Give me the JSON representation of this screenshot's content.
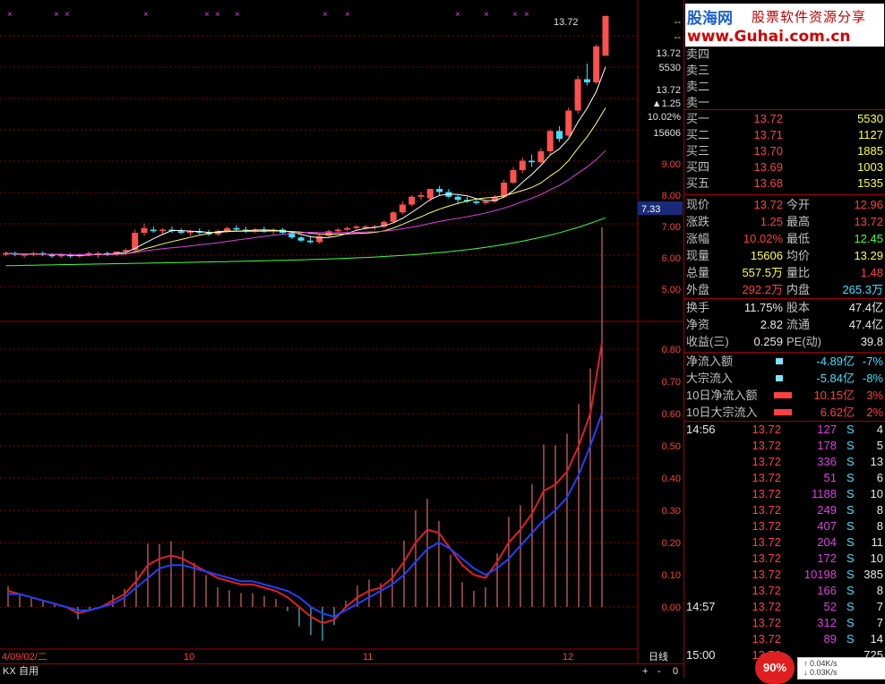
{
  "chart": {
    "price_axis": [
      "--",
      "--",
      "13.72",
      "5530",
      "13.72",
      "▲1.25",
      "10.02%",
      "15606",
      "9.00",
      "8.00",
      "7.00",
      "6.00",
      "5.00"
    ],
    "price_axis_highlight": "7.33",
    "top_label": "13.72",
    "indicator_axis": [
      "0.80",
      "0.70",
      "0.60",
      "0.50",
      "0.40",
      "0.30",
      "0.20",
      "0.10",
      "0.00"
    ],
    "date_labels": [
      "4/09/02/二",
      "10",
      "11",
      "12"
    ],
    "period_label": "日线",
    "bottom_tabs": [
      "KX",
      "自用"
    ],
    "zoom_buttons": [
      "+",
      "-",
      "0"
    ],
    "colors": {
      "up": "#ff5050",
      "down": "#40e0ff",
      "ma5": "#ffffff",
      "ma10": "#ffff60",
      "ma20": "#e040e0",
      "ma60": "#40ff40",
      "grid": "#8b0000"
    }
  },
  "logo": {
    "brand": "股海网",
    "slogan": "股票软件资源分享",
    "url": "www.Guhai.com.cn"
  },
  "order_book": {
    "sells": [
      {
        "label": "卖四",
        "price": "",
        "vol": ""
      },
      {
        "label": "卖三",
        "price": "",
        "vol": ""
      },
      {
        "label": "卖二",
        "price": "",
        "vol": ""
      },
      {
        "label": "卖一",
        "price": "",
        "vol": ""
      }
    ],
    "buys": [
      {
        "label": "买一",
        "price": "13.72",
        "vol": "5530"
      },
      {
        "label": "买二",
        "price": "13.71",
        "vol": "1127"
      },
      {
        "label": "买三",
        "price": "13.70",
        "vol": "1885"
      },
      {
        "label": "买四",
        "price": "13.69",
        "vol": "1003"
      },
      {
        "label": "买五",
        "price": "13.68",
        "vol": "1535"
      }
    ]
  },
  "quote": [
    {
      "l1": "现价",
      "v1": "13.72",
      "l2": "今开",
      "v2": "12.96"
    },
    {
      "l1": "涨跌",
      "v1": "1.25",
      "l2": "最高",
      "v2": "13.72"
    },
    {
      "l1": "涨幅",
      "v1": "10.02%",
      "l2": "最低",
      "v2": "12.45"
    },
    {
      "l1": "现量",
      "v1": "15606",
      "l2": "均价",
      "v2": "13.29"
    },
    {
      "l1": "总量",
      "v1": "557.5万",
      "l2": "量比",
      "v2": "1.48"
    },
    {
      "l1": "外盘",
      "v1": "292.2万",
      "l2": "内盘",
      "v2": "265.3万"
    }
  ],
  "fundamentals": [
    {
      "l1": "换手",
      "v1": "11.75%",
      "l2": "股本",
      "v2": "47.4亿"
    },
    {
      "l1": "净资",
      "v1": "2.82",
      "l2": "流通",
      "v2": "47.4亿"
    },
    {
      "l1": "收益(三)",
      "v1": "0.259",
      "l2": "PE(动)",
      "v2": "39.8"
    }
  ],
  "flows": [
    {
      "label": "净流入额",
      "value": "-4.89亿",
      "pct": "-7%"
    },
    {
      "label": "大宗流入",
      "value": "-5.84亿",
      "pct": "-8%"
    },
    {
      "label": "10日净流入额",
      "value": "10.15亿",
      "pct": "3%"
    },
    {
      "label": "10日大宗流入",
      "value": "6.62亿",
      "pct": "2%"
    }
  ],
  "ticks": [
    {
      "time": "14:56",
      "price": "13.72",
      "vol": "127",
      "side": "S",
      "n": "4"
    },
    {
      "time": "",
      "price": "13.72",
      "vol": "178",
      "side": "S",
      "n": "5"
    },
    {
      "time": "",
      "price": "13.72",
      "vol": "336",
      "side": "S",
      "n": "13"
    },
    {
      "time": "",
      "price": "13.72",
      "vol": "51",
      "side": "S",
      "n": "6"
    },
    {
      "time": "",
      "price": "13.72",
      "vol": "1188",
      "side": "S",
      "n": "10"
    },
    {
      "time": "",
      "price": "13.72",
      "vol": "249",
      "side": "S",
      "n": "8"
    },
    {
      "time": "",
      "price": "13.72",
      "vol": "407",
      "side": "S",
      "n": "8"
    },
    {
      "time": "",
      "price": "13.72",
      "vol": "204",
      "side": "S",
      "n": "11"
    },
    {
      "time": "",
      "price": "13.72",
      "vol": "172",
      "side": "S",
      "n": "10"
    },
    {
      "time": "",
      "price": "13.72",
      "vol": "10198",
      "side": "S",
      "n": "385"
    },
    {
      "time": "",
      "price": "13.72",
      "vol": "166",
      "side": "S",
      "n": "8"
    },
    {
      "time": "14:57",
      "price": "13.72",
      "vol": "52",
      "side": "S",
      "n": "7"
    },
    {
      "time": "",
      "price": "13.72",
      "vol": "312",
      "side": "S",
      "n": "7"
    },
    {
      "time": "",
      "price": "13.72",
      "vol": "89",
      "side": "S",
      "n": "14"
    },
    {
      "time": "15:00",
      "price": "13.72",
      "vol": "",
      "side": "",
      "n": "725"
    }
  ],
  "widget": {
    "percent": "90%",
    "up_speed": "0.04K/s",
    "down_speed": "0.03K/s"
  }
}
